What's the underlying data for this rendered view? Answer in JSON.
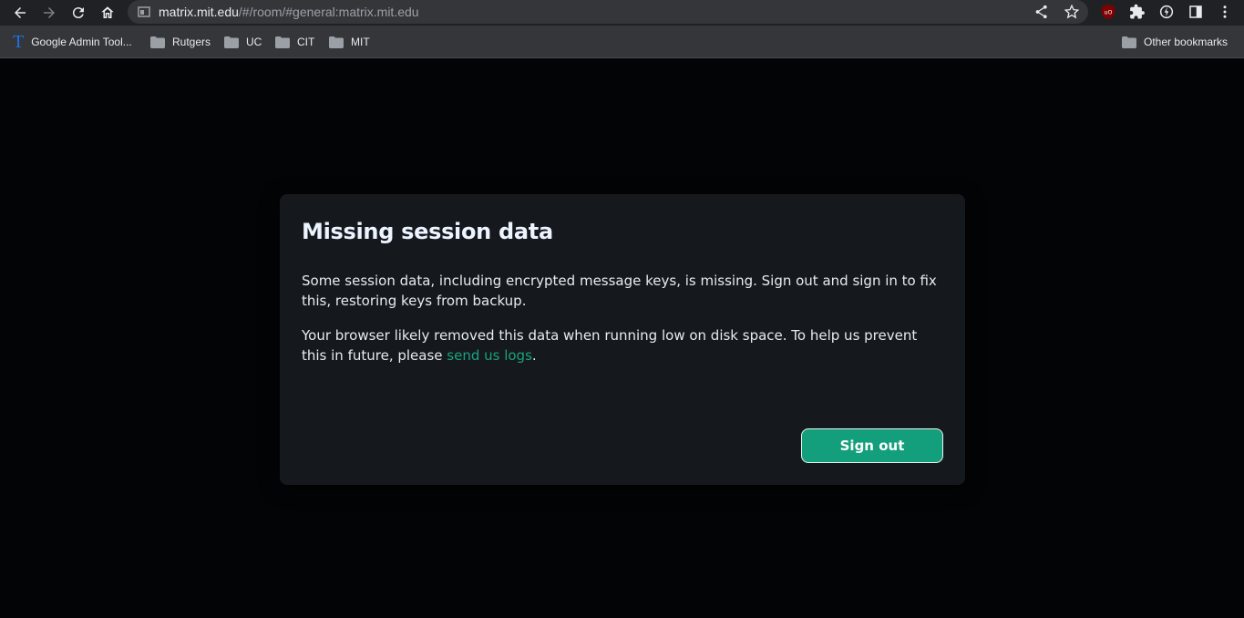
{
  "browser": {
    "url_host": "matrix.mit.edu",
    "url_rest": "/#/room/#general:matrix.mit.edu",
    "bookmarks": [
      {
        "label": "Google Admin Tool..."
      },
      {
        "label": "Rutgers"
      },
      {
        "label": "UC"
      },
      {
        "label": "CIT"
      },
      {
        "label": "MIT"
      }
    ],
    "other_bookmarks": "Other bookmarks"
  },
  "dialog": {
    "title": "Missing session data",
    "paragraph1": "Some session data, including encrypted message keys, is missing. Sign out and sign in to fix this, restoring keys from backup.",
    "paragraph2_prefix": "Your browser likely removed this data when running low on disk space. To help us prevent this in future, please ",
    "paragraph2_link": "send us logs",
    "paragraph2_suffix": ".",
    "signout_label": "Sign out"
  }
}
